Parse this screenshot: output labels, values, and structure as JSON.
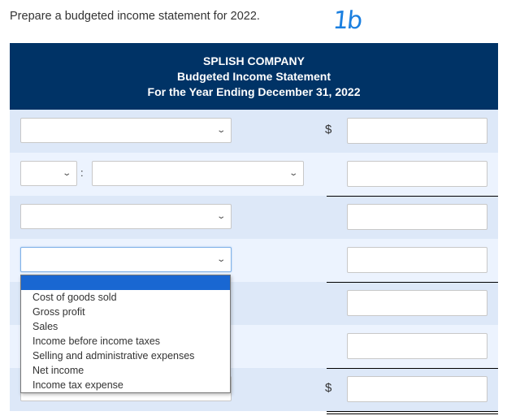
{
  "instruction": "Prepare a budgeted income statement for 2022.",
  "annotation": "1b",
  "header": {
    "company": "SPLISH COMPANY",
    "statement": "Budgeted Income Statement",
    "period": "For the Year Ending December 31, 2022"
  },
  "currency_symbol": "$",
  "colon": ":",
  "chevron": "⌄",
  "rows": [
    {
      "select_value": "",
      "amount": "",
      "currency": true
    },
    {
      "prefix_select_value": "",
      "select_value": "",
      "amount": ""
    },
    {
      "select_value": "",
      "amount": ""
    },
    {
      "select_value": "",
      "amount": "",
      "focused": true
    },
    {
      "amount": ""
    },
    {
      "amount": ""
    },
    {
      "select_value": "",
      "amount": "",
      "currency": true
    }
  ],
  "dropdown": {
    "options": [
      "",
      "Cost of goods sold",
      "Gross profit",
      "Sales",
      "Income before income taxes",
      "Selling and administrative expenses",
      "Net income",
      "Income tax expense"
    ],
    "highlighted_index": 0
  }
}
